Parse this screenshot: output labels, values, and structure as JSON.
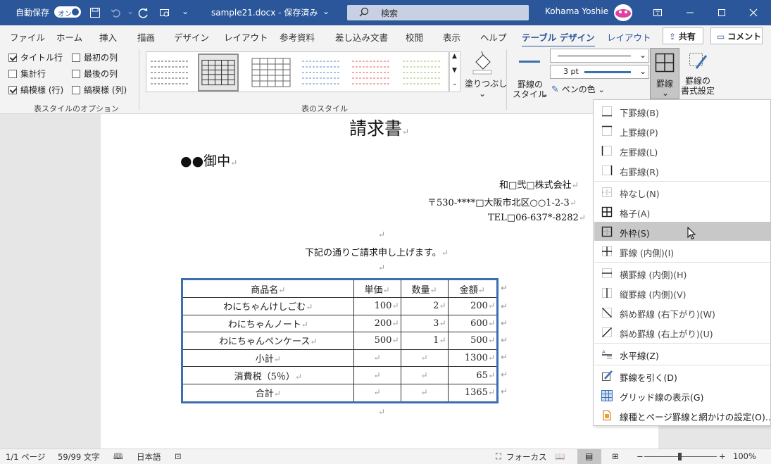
{
  "titlebar": {
    "autosave_label": "自動保存",
    "autosave_state": "オン",
    "doc_title": "sample21.docx - 保存済み",
    "search_placeholder": "検索",
    "user_name": "Kohama Yoshie",
    "bg_color": "#2b579a"
  },
  "tabs": {
    "items": [
      "ファイル",
      "ホーム",
      "挿入",
      "描画",
      "デザイン",
      "レイアウト",
      "参考資料",
      "差し込み文書",
      "校閲",
      "表示",
      "ヘルプ",
      "テーブル デザイン",
      "レイアウト"
    ],
    "active": "テーブル デザイン",
    "share_label": "共有",
    "comment_label": "コメント"
  },
  "ribbon": {
    "style_options": {
      "title_row": "タイトル行",
      "first_col": "最初の列",
      "total_row": "集計行",
      "last_col": "最後の列",
      "banded_rows": "縞模様 (行)",
      "banded_cols": "縞模様 (列)",
      "group_label": "表スタイルのオプション"
    },
    "table_styles_label": "表のスタイル",
    "shading_label": "塗りつぶし",
    "border_style_label_1": "罫線の",
    "border_style_label_2": "スタイル",
    "pen_weight": "3 pt",
    "pen_color_label": "ペンの色",
    "borders_label": "罫線",
    "border_painter_1": "罫線の",
    "border_painter_2": "書式設定"
  },
  "document": {
    "title": "請求書",
    "addressee": "●●御中",
    "company": "和□弐□株式会社",
    "address": "〒530-****□大阪市北区○○1-2-3",
    "tel": "TEL□06-637*-8282",
    "intro": "下記の通りご請求申し上げます。",
    "para_mark": "↵",
    "table": {
      "headers": [
        "商品名",
        "単価",
        "数量",
        "金額"
      ],
      "rows": [
        [
          "わにちゃんけしごむ",
          "100",
          "2",
          "200"
        ],
        [
          "わにちゃんノート",
          "200",
          "3",
          "600"
        ],
        [
          "わにちゃんペンケース",
          "500",
          "1",
          "500"
        ],
        [
          "小計",
          "",
          "",
          "1300"
        ],
        [
          "消費税（5％）",
          "",
          "",
          "65"
        ],
        [
          "合計",
          "",
          "",
          "1365"
        ]
      ]
    }
  },
  "menu": {
    "items": [
      {
        "label": "下罫線(B)",
        "icon": "bottom-border-icon"
      },
      {
        "label": "上罫線(P)",
        "icon": "top-border-icon"
      },
      {
        "label": "左罫線(L)",
        "icon": "left-border-icon"
      },
      {
        "label": "右罫線(R)",
        "icon": "right-border-icon"
      },
      {
        "label": "枠なし(N)",
        "icon": "no-border-icon"
      },
      {
        "label": "格子(A)",
        "icon": "all-borders-icon"
      },
      {
        "label": "外枠(S)",
        "icon": "outside-borders-icon"
      },
      {
        "label": "罫線 (内側)(I)",
        "icon": "inside-borders-icon"
      },
      {
        "label": "横罫線 (内側)(H)",
        "icon": "inside-horizontal-border-icon"
      },
      {
        "label": "縦罫線 (内側)(V)",
        "icon": "inside-vertical-border-icon"
      },
      {
        "label": "斜め罫線 (右下がり)(W)",
        "icon": "diagonal-down-border-icon"
      },
      {
        "label": "斜め罫線 (右上がり)(U)",
        "icon": "diagonal-up-border-icon"
      },
      {
        "label": "水平線(Z)",
        "icon": "horizontal-line-icon"
      },
      {
        "label": "罫線を引く(D)",
        "icon": "draw-table-icon"
      },
      {
        "label": "グリッド線の表示(G)",
        "icon": "view-gridlines-icon"
      },
      {
        "label": "線種とページ罫線と網かけの設定(O)...",
        "icon": "borders-shading-icon"
      }
    ],
    "highlighted": "外枠(S)"
  },
  "status": {
    "page": "1/1 ページ",
    "words": "59/99 文字",
    "language": "日本語",
    "focus": "フォーカス",
    "zoom": "100%"
  }
}
